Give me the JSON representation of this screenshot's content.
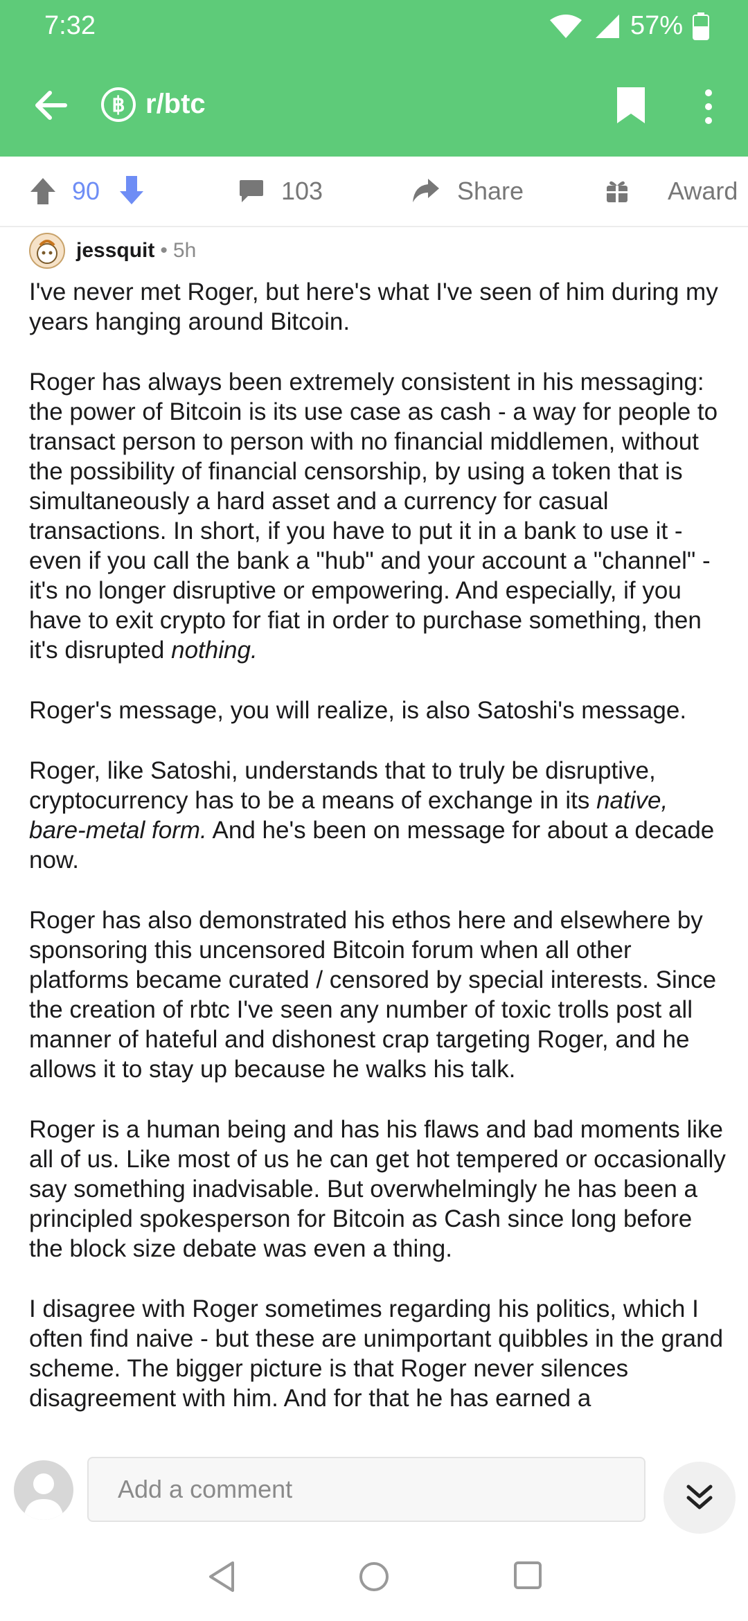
{
  "status_bar": {
    "time": "7:32",
    "battery": "57%"
  },
  "header": {
    "subreddit_badge": "฿",
    "subreddit": "r/btc"
  },
  "actions": {
    "score": "90",
    "comments": "103",
    "share": "Share",
    "award": "Award"
  },
  "comment": {
    "author": "jessquit",
    "separator": "•",
    "age": "5h",
    "paragraphs": {
      "p1": "I've never met Roger, but here's what I've seen of him during my years hanging around Bitcoin.",
      "p2": "Roger has always been extremely consistent in his messaging: the power of Bitcoin is its use case as cash - a way for people to transact person to person with no financial middlemen, without the possibility of financial censorship, by using a token that is simultaneously a hard asset and a currency for casual transactions.  In short, if you have to put it in a bank to use it - even if you call the bank a \"hub\" and your account a \"channel\" - it's no longer disruptive or empowering. And especially, if you have to exit crypto for fiat in order to purchase something, then it's disrupted ",
      "p2_em": "nothing.",
      "p3": "Roger's message, you will realize, is also Satoshi's message.",
      "p4_a": "Roger, like Satoshi, understands that to truly be disruptive, cryptocurrency has to be a means of exchange in its ",
      "p4_em": "native, bare-metal form.",
      "p4_b": " And he's been on message for about a decade now.",
      "p5": "Roger has also demonstrated his ethos here and elsewhere by sponsoring this uncensored Bitcoin forum when all other platforms became curated / censored by special interests. Since the creation of rbtc I've seen any number of toxic trolls post all manner of hateful and dishonest crap targeting Roger, and he allows it to stay up because he walks his talk.",
      "p6": "Roger is a human being and has his flaws and bad moments like all of us. Like most of us he can get hot tempered or occasionally say something inadvisable.  But overwhelmingly he has been a principled spokesperson for Bitcoin as Cash since long before the block size debate was even a thing.",
      "p7": "I disagree with Roger sometimes regarding his politics, which I often find naive - but these are unimportant quibbles in the grand scheme. The bigger picture is that Roger never silences disagreement with him. And for that he has earned a"
    }
  },
  "composer": {
    "placeholder": "Add a comment"
  },
  "colors": {
    "header_green": "#5ecb79",
    "vote_blue": "#6e8df5",
    "icon_gray": "#777777"
  }
}
